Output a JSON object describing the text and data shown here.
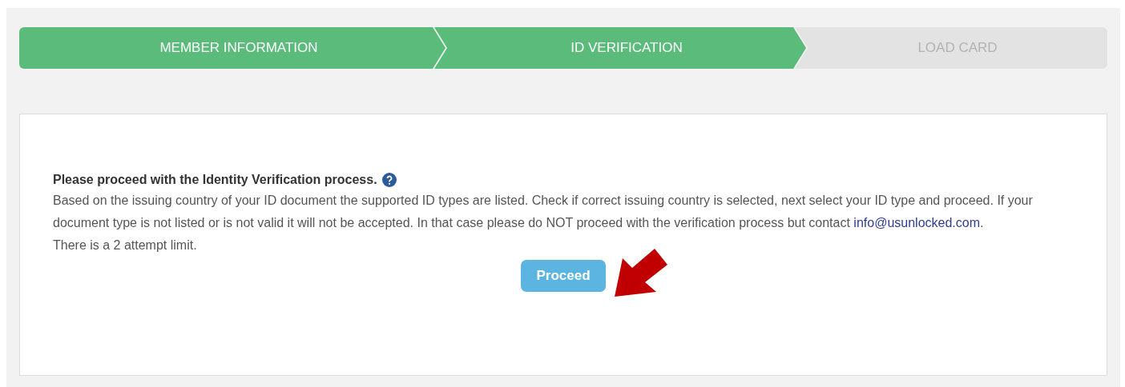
{
  "steps": [
    {
      "label": "MEMBER INFORMATION",
      "completed": true
    },
    {
      "label": "ID VERIFICATION",
      "completed": true
    },
    {
      "label": "LOAD CARD",
      "completed": false
    }
  ],
  "card": {
    "heading": "Please proceed with the Identity Verification process.",
    "body_text": "Based on the issuing country of your ID document the supported ID types are listed. Check if correct issuing country is selected, next select your ID type and proceed. If your document type is not listed or is not valid it will not be accepted. In that case please do NOT proceed with the verification process but contact",
    "link": "info@usunlocked.com",
    "body_end": ".",
    "note": "There is a 2 attempt limit.",
    "button": "Proceed"
  }
}
